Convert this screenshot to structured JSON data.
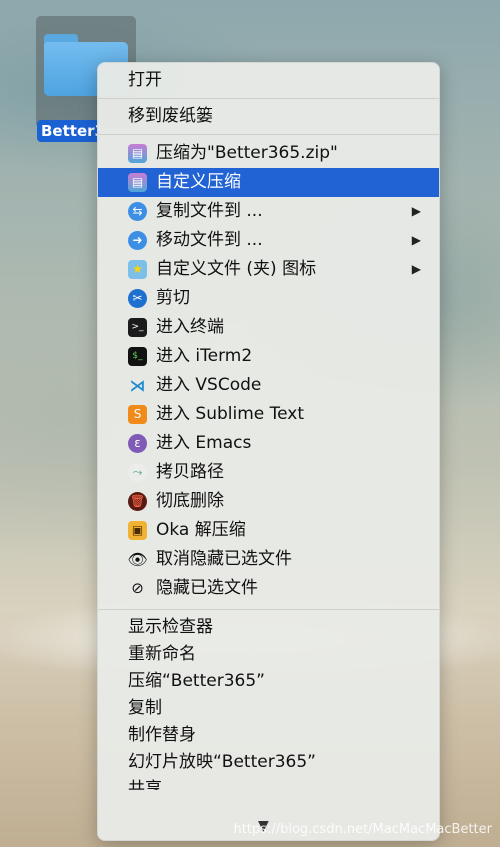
{
  "file": {
    "label": "Better365"
  },
  "menu": {
    "top": [
      {
        "label": "打开"
      },
      {
        "label": "移到废纸篓"
      }
    ],
    "plugins": [
      {
        "label": "压缩为\"Better365.zip\"",
        "icon": "rar-stack-icon"
      },
      {
        "label": "自定义压缩",
        "icon": "rar-stack-icon",
        "selected": true
      },
      {
        "label": "复制文件到 ...",
        "icon": "copy-arrows-icon",
        "submenu": true
      },
      {
        "label": "移动文件到 ...",
        "icon": "move-arrow-icon",
        "submenu": true
      },
      {
        "label": "自定义文件 (夹) 图标",
        "icon": "star-folder-icon",
        "submenu": true
      },
      {
        "label": "剪切",
        "icon": "scissors-icon"
      },
      {
        "label": "进入终端",
        "icon": "terminal-icon"
      },
      {
        "label": "进入 iTerm2",
        "icon": "iterm-icon"
      },
      {
        "label": "进入 VSCode",
        "icon": "vscode-icon"
      },
      {
        "label": "进入 Sublime Text",
        "icon": "sublime-icon"
      },
      {
        "label": "进入 Emacs",
        "icon": "emacs-icon"
      },
      {
        "label": "拷贝路径",
        "icon": "path-icon"
      },
      {
        "label": "彻底删除",
        "icon": "trash-icon"
      },
      {
        "label": "Oka 解压缩",
        "icon": "oka-icon"
      },
      {
        "label": "取消隐藏已选文件",
        "icon": "eye-icon"
      },
      {
        "label": "隐藏已选文件",
        "icon": "eye-hidden-icon"
      }
    ],
    "bottom": [
      {
        "label": "显示检查器"
      },
      {
        "label": "重新命名"
      },
      {
        "label": "压缩“Better365”"
      },
      {
        "label": "复制"
      },
      {
        "label": "制作替身"
      },
      {
        "label": "幻灯片放映“Better365”"
      },
      {
        "label": "共享"
      }
    ],
    "submenu_arrow": "▶",
    "scroll_arrow": "▼"
  },
  "watermark": "https://blog.csdn.net/MacMacMacBetter"
}
